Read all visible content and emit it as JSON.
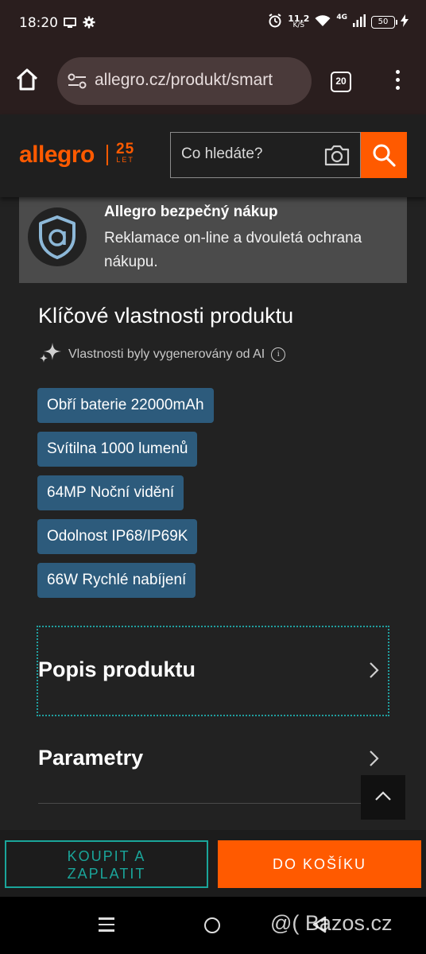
{
  "statusbar": {
    "time": "18:20",
    "net_speed_value": "11,2",
    "net_speed_unit": "K/S",
    "network_type": "4G",
    "battery": "50"
  },
  "browser": {
    "url": "allegro.cz/produkt/smart",
    "tab_count": "20"
  },
  "header": {
    "logo_text": "allegro",
    "logo_anniversary_number": "25",
    "logo_anniversary_word": "LET",
    "search_placeholder": "Co hledáte?",
    "brand_color": "#ff5a00"
  },
  "safe_purchase": {
    "title": "Allegro bezpečný nákup",
    "description": "Reklamace on-line a dvouletá ochrana nákupu."
  },
  "key_properties": {
    "title": "Klíčové vlastnosti produktu",
    "ai_note": "Vlastnosti byly vygenerovány od AI",
    "tags": [
      "Obří baterie 22000mAh",
      "Svítilna 1000 lumenů",
      "64MP Noční vidění",
      "Odolnost IP68/IP69K",
      "66W Rychlé nabíjení"
    ]
  },
  "sections": {
    "description": "Popis produktu",
    "parameters": "Parametry"
  },
  "actions": {
    "buy_now_line1": "KOUPIT A",
    "buy_now_line2": "ZAPLATIT",
    "add_to_cart": "DO KOŠÍKU",
    "accent_color": "#1aa59a"
  },
  "watermark": "@( Bazos.cz"
}
